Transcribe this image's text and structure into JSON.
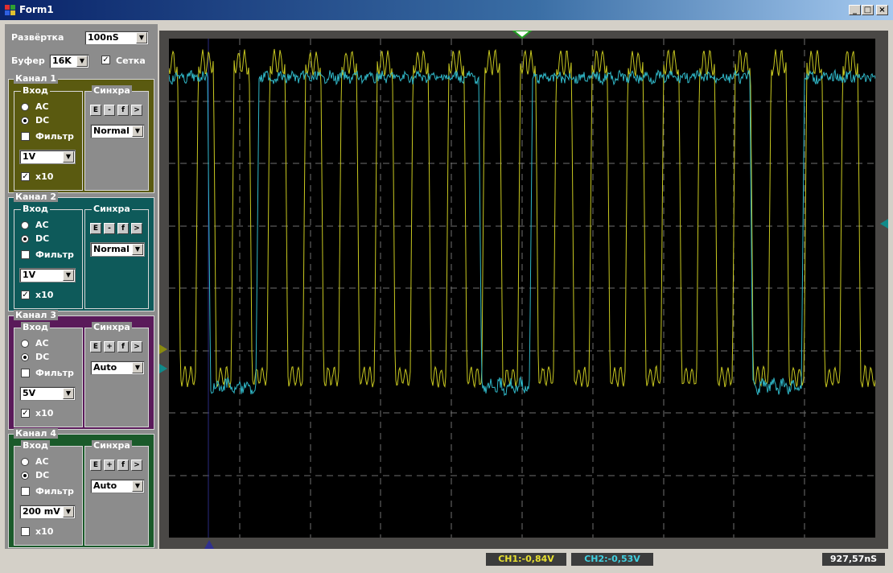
{
  "window": {
    "title": "Form1",
    "minimize": "_",
    "maximize": "□",
    "close": "×"
  },
  "controls": {
    "sweep_label": "Развёртка",
    "sweep_value": "100nS",
    "buffer_label": "Буфер",
    "buffer_value": "16K",
    "grid_label": "Сетка",
    "grid_checked": true
  },
  "channels": [
    {
      "label": "Канал 1",
      "input_label": "Вход",
      "sync_label": "Синхра",
      "ac": "AC",
      "dc": "DC",
      "coupling": "DC",
      "filter_label": "Фильтр",
      "filter": false,
      "volts": "1V",
      "x10_label": "x10",
      "x10": true,
      "sync_buttons": [
        "E",
        "-",
        "f",
        ">"
      ],
      "sync_mode": "Normal",
      "color": "#5a5a10"
    },
    {
      "label": "Канал 2",
      "input_label": "Вход",
      "sync_label": "Синхра",
      "ac": "AC",
      "dc": "DC",
      "coupling": "DC",
      "filter_label": "Фильтр",
      "filter": false,
      "volts": "1V",
      "x10_label": "x10",
      "x10": true,
      "sync_buttons": [
        "E",
        "-",
        "f",
        ">"
      ],
      "sync_mode": "Normal",
      "color": "#0e5a5a"
    },
    {
      "label": "Канал 3",
      "input_label": "Вход",
      "sync_label": "Синхра",
      "ac": "AC",
      "dc": "DC",
      "coupling": "DC",
      "filter_label": "Фильтр",
      "filter": false,
      "volts": "5V",
      "x10_label": "x10",
      "x10": true,
      "sync_buttons": [
        "E",
        "+",
        "f",
        ">"
      ],
      "sync_mode": "Auto",
      "color": "#5a1a5a"
    },
    {
      "label": "Канал 4",
      "input_label": "Вход",
      "sync_label": "Синхра",
      "ac": "AC",
      "dc": "DC",
      "coupling": "DC",
      "filter_label": "Фильтр",
      "filter": false,
      "volts": "200 mV",
      "x10_label": "x10",
      "x10": false,
      "sync_buttons": [
        "E",
        "+",
        "f",
        ">"
      ],
      "sync_mode": "Auto",
      "color": "#1a5a2a"
    }
  ],
  "status": {
    "ch1": "CH1:-0,84V",
    "ch2": "CH2:-0,53V",
    "time": "927,57nS",
    "ch1_color": "#e8e030",
    "ch2_color": "#40d0e0",
    "time_color": "#ffffff"
  },
  "traces": {
    "ch1_color": "#c8c820",
    "ch2_color": "#30b8c8"
  }
}
